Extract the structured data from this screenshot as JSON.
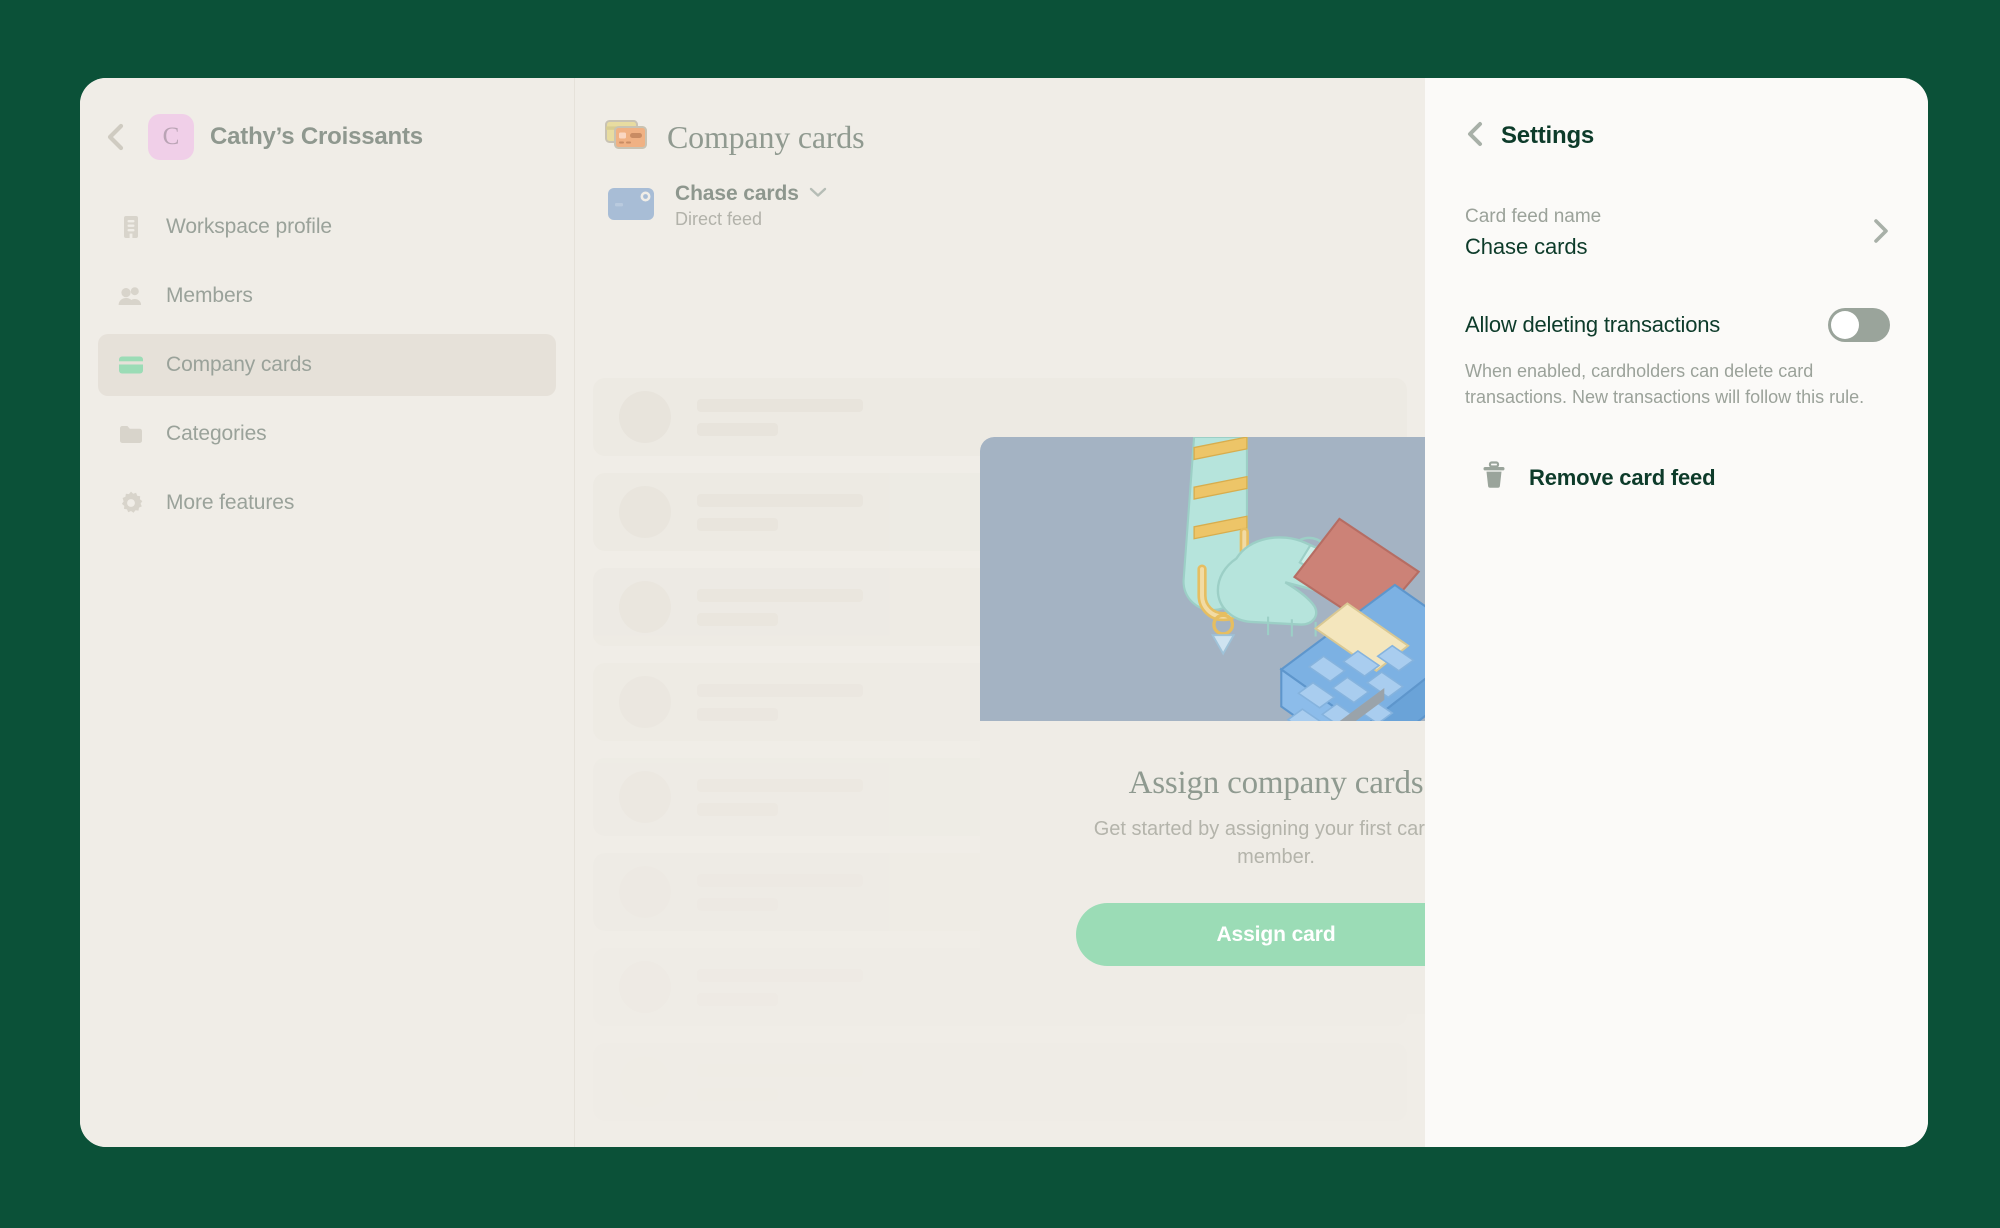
{
  "theme": {
    "desktop_bg": "#0b5138",
    "window_bg": "#f0ede7",
    "settings_bg": "#fbfaf8",
    "accent_green": "#9bdcb6",
    "text_dark": "#0d3b2a",
    "muted": "#9ba29a",
    "avatar_pink": "#f0cfe8",
    "illustration_bg": "#a4b3c3"
  },
  "sidebar": {
    "back_icon": "chevron-left-icon",
    "workspace_initial": "C",
    "workspace_name": "Cathy’s Croissants",
    "items": [
      {
        "label": "Workspace profile",
        "icon": "building-icon",
        "active": false
      },
      {
        "label": "Members",
        "icon": "people-icon",
        "active": false
      },
      {
        "label": "Company cards",
        "icon": "credit-card-icon",
        "active": true
      },
      {
        "label": "Categories",
        "icon": "folder-icon",
        "active": false
      },
      {
        "label": "More features",
        "icon": "gear-icon",
        "active": false
      }
    ]
  },
  "main": {
    "title": "Company cards",
    "title_icon": "stacked-cards-icon",
    "feed": {
      "icon": "bank-card-icon",
      "name": "Chase cards",
      "chevron": "chevron-down-icon",
      "subtitle": "Direct feed"
    },
    "skeleton_row_count": 8,
    "empty_state": {
      "illustration": "hand-tapping-card-on-terminal-illustration",
      "title": "Assign company cards",
      "subtitle": "Get started by assigning your first card to member.",
      "button_label": "Assign card"
    }
  },
  "settings": {
    "back_icon": "chevron-left-icon",
    "title": "Settings",
    "card_feed_name": {
      "label": "Card feed name",
      "value": "Chase cards",
      "chevron": "chevron-right-icon"
    },
    "allow_deleting": {
      "label": "Allow deleting transactions",
      "enabled": false,
      "help": "When enabled, cardholders can delete card transactions. New transactions will follow this rule."
    },
    "remove": {
      "icon": "trash-icon",
      "label": "Remove card feed"
    }
  }
}
